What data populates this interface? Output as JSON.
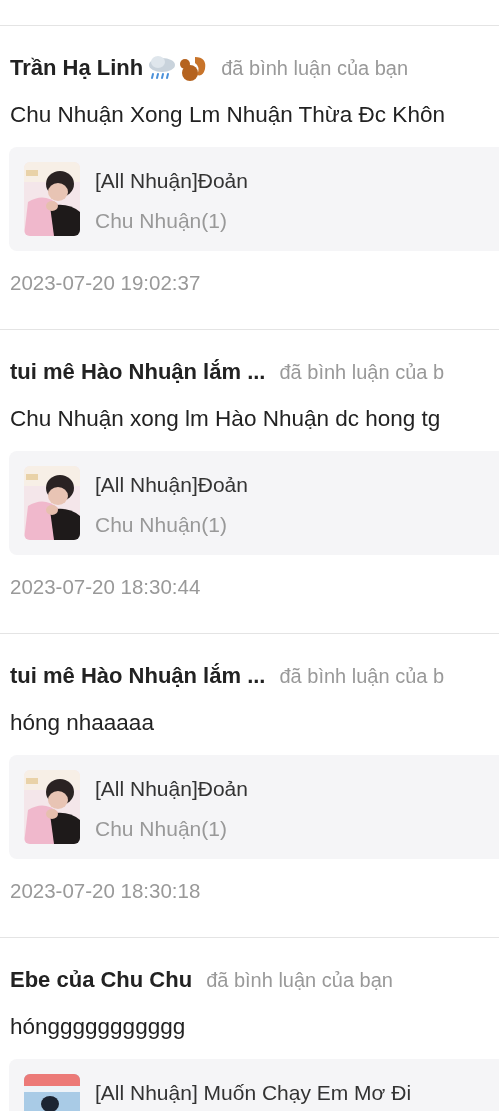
{
  "notifications": [
    {
      "name": "Trần Hạ Linh",
      "badge_icons": true,
      "action": "đã bình luận của bạn",
      "comment": "Chu Nhuận Xong Lm Nhuận Thừa Đc Khôn",
      "card": {
        "title": "[All Nhuận]Đoản",
        "subtitle": "Chu Nhuận(1)",
        "kind": "pink"
      },
      "time": "2023-07-20 19:02:37"
    },
    {
      "name": "tui mê Hào Nhuận lắm ...",
      "badge_icons": false,
      "action": "đã bình luận của b",
      "comment": "Chu Nhuận xong lm Hào Nhuận dc hong tg",
      "card": {
        "title": "[All Nhuận]Đoản",
        "subtitle": "Chu Nhuận(1)",
        "kind": "pink"
      },
      "time": "2023-07-20 18:30:44"
    },
    {
      "name": "tui mê Hào Nhuận lắm ...",
      "badge_icons": false,
      "action": "đã bình luận của b",
      "comment": "hóng nhaaaaa",
      "card": {
        "title": "[All Nhuận]Đoản",
        "subtitle": "Chu Nhuận(1)",
        "kind": "pink"
      },
      "time": "2023-07-20 18:30:18"
    },
    {
      "name": "Ebe của Chu Chu",
      "badge_icons": false,
      "action": "đã bình luận của bạn",
      "comment": "hónggggggggggg",
      "card": {
        "title": "[All Nhuận] Muốn Chạy Em Mơ Đi",
        "kind": "blue"
      }
    }
  ]
}
